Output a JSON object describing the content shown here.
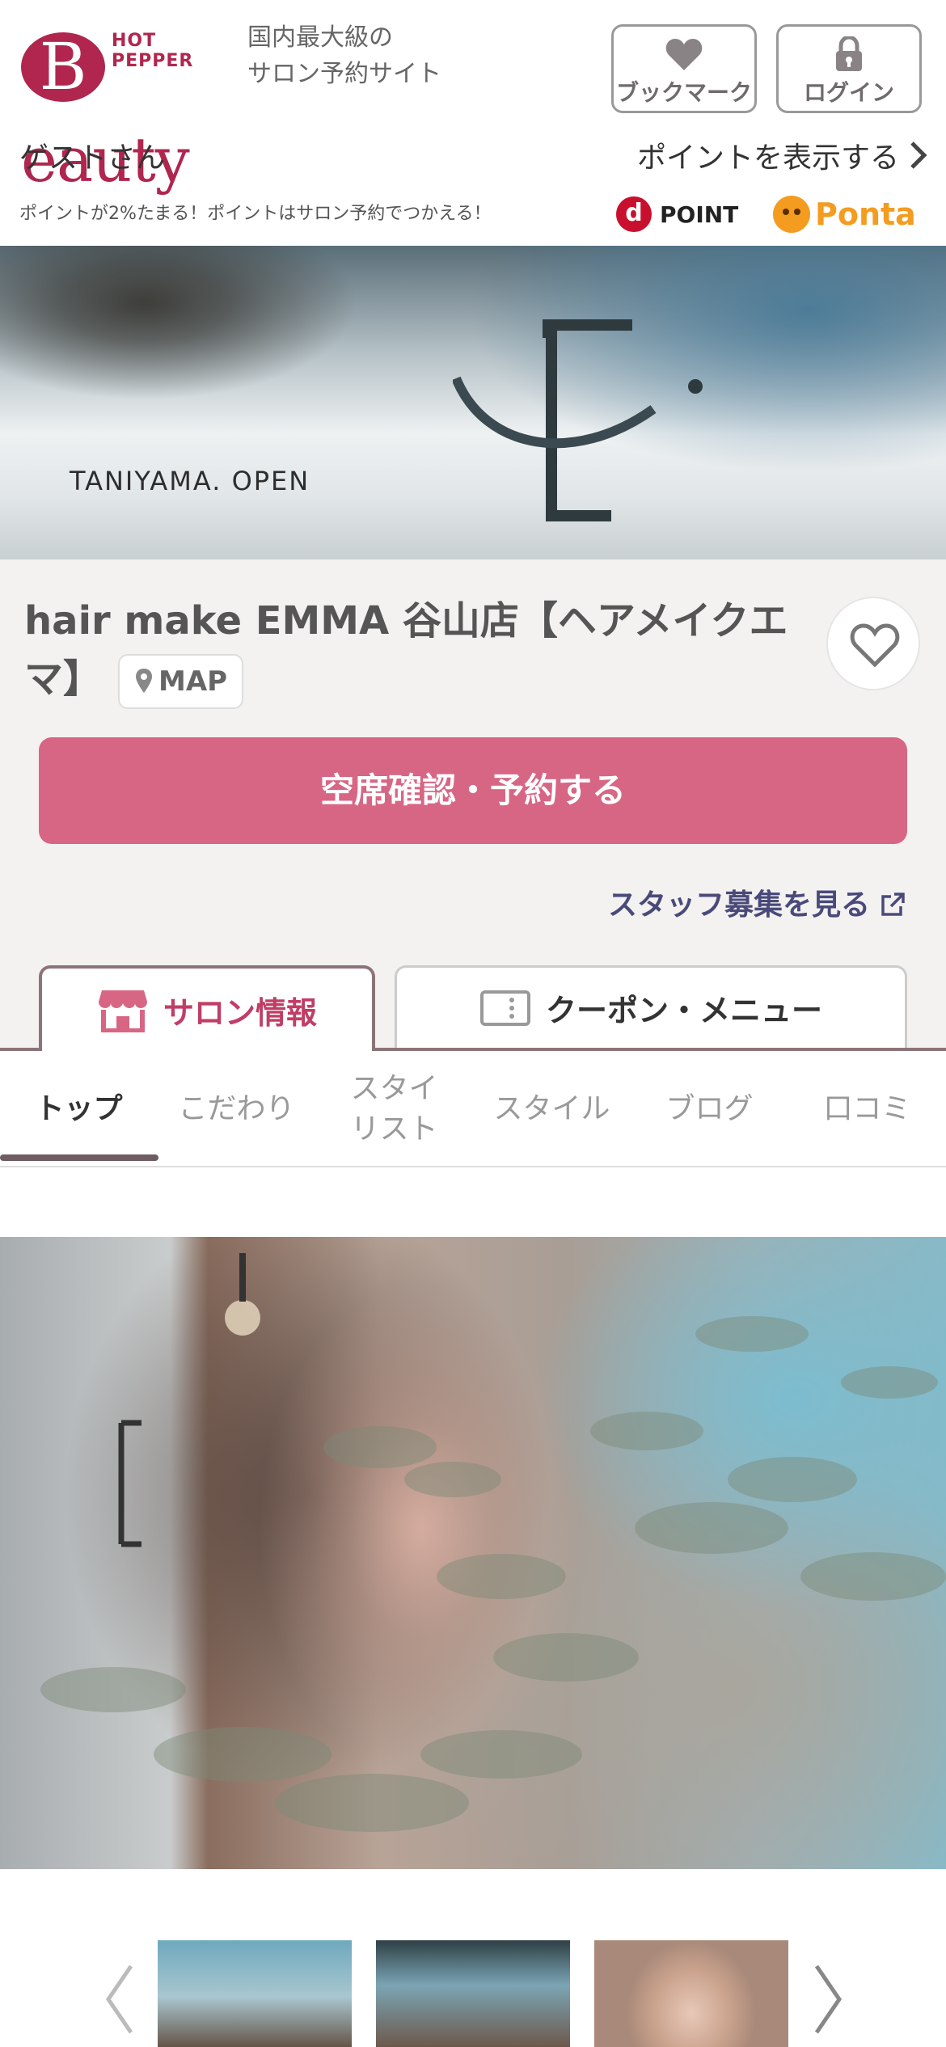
{
  "header": {
    "logo_top": "HOT PEPPER",
    "logo_letter": "B",
    "logo_rest": "eauty",
    "tagline_1": "国内最大級の",
    "tagline_2": "サロン予約サイト",
    "bookmark_label": "ブックマーク",
    "login_label": "ログイン"
  },
  "user": {
    "greeting": "ゲストさん",
    "points_link": "ポイントを表示する"
  },
  "promo": {
    "text": "ポイントが2%たまる！ポイントはサロン予約でつかえる！",
    "dpoint_mark": "d",
    "dpoint_label": "POINT",
    "ponta_label": "Ponta"
  },
  "banner": {
    "caption": "TANIYAMA. OPEN"
  },
  "salon": {
    "name": "hair make EMMA 谷山店【ヘアメイクエマ】",
    "map_label": "MAP",
    "reserve_label": "空席確認・予約する",
    "staff_link": "スタッフ募集を見る"
  },
  "tabs": [
    {
      "label": "サロン情報",
      "active": true
    },
    {
      "label": "クーポン・メニュー",
      "active": false
    }
  ],
  "subnav": [
    {
      "label": "トップ",
      "active": true
    },
    {
      "label": "こだわり",
      "active": false
    },
    {
      "label": "スタイリスト",
      "active": false
    },
    {
      "label": "スタイル",
      "active": false
    },
    {
      "label": "ブログ",
      "active": false
    },
    {
      "label": "口コミ",
      "active": false
    }
  ],
  "colors": {
    "brand": "#b0264f",
    "reserve": "#d76684",
    "tab_active_text": "#c03e66",
    "tab_border": "#8c7478",
    "link": "#4a4a7a"
  },
  "icons": {
    "bookmark": "heart-icon",
    "login": "lock-icon",
    "points": "chevron-right-icon",
    "map": "map-pin-icon",
    "favorite": "heart-outline-icon",
    "external": "external-link-icon",
    "salon_tab": "store-icon",
    "coupon_tab": "coupon-icon",
    "gallery_prev": "chevron-left-icon",
    "gallery_next": "chevron-right-icon"
  }
}
